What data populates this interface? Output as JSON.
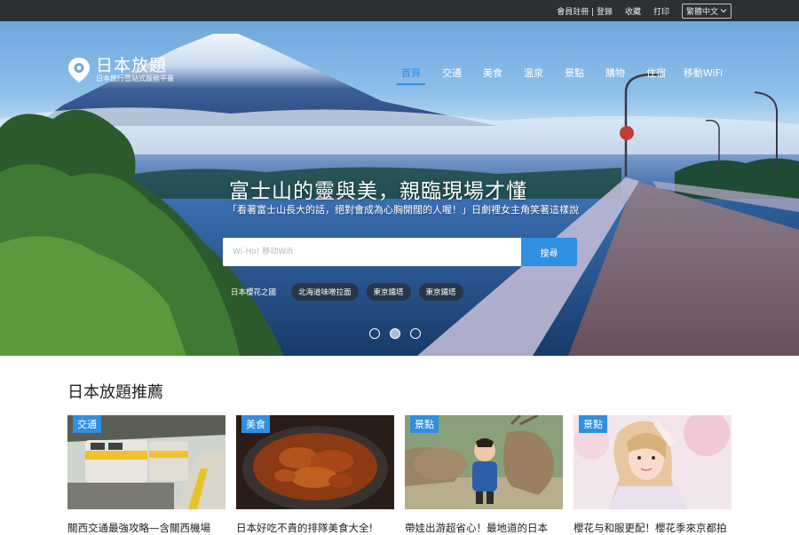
{
  "topbar": {
    "register_login": "會員註冊 | 登錄",
    "favorites": "收藏",
    "print": "打印",
    "language": "繁體中文"
  },
  "brand": {
    "title": "日本放題",
    "subtitle": "日本旅行壹站式服務平臺"
  },
  "nav": {
    "items": [
      {
        "label": "首頁",
        "active": true
      },
      {
        "label": "交通"
      },
      {
        "label": "美食"
      },
      {
        "label": "溫泉"
      },
      {
        "label": "景點"
      },
      {
        "label": "購物"
      },
      {
        "label": "住宿"
      },
      {
        "label": "移動WiFi"
      }
    ]
  },
  "hero": {
    "headline": "富士山的靈與美，親臨現場才懂",
    "subline": "「看著富士山長大的話，絕對會成為心胸開闊的人喔！」日劇裡女主角笑著這樣說",
    "search_placeholder": "Wi-Ho! 移动Wifi",
    "search_button": "搜尋",
    "tags": [
      "日本櫻花之國",
      "北海道味噌拉面",
      "東京鐵塔",
      "東京鐵塔"
    ],
    "slides": {
      "count": 3,
      "active_index": 1
    }
  },
  "recommend": {
    "title": "日本放題推薦",
    "cards": [
      {
        "category": "交通",
        "title": "關西交通最強攻略—含關西機場"
      },
      {
        "category": "美食",
        "title": "日本好吃不貴的排隊美食大全!"
      },
      {
        "category": "景點",
        "title": "帶娃出游超省心！最地道的日本"
      },
      {
        "category": "景點",
        "title": "櫻花与和服更配！櫻花季來京都拍"
      }
    ]
  },
  "colors": {
    "accent": "#2f8fe0",
    "topbar_bg": "#2b3035"
  },
  "icons": {
    "logo": "location-pin-icon",
    "language_dropdown": "chevron-down-icon"
  }
}
